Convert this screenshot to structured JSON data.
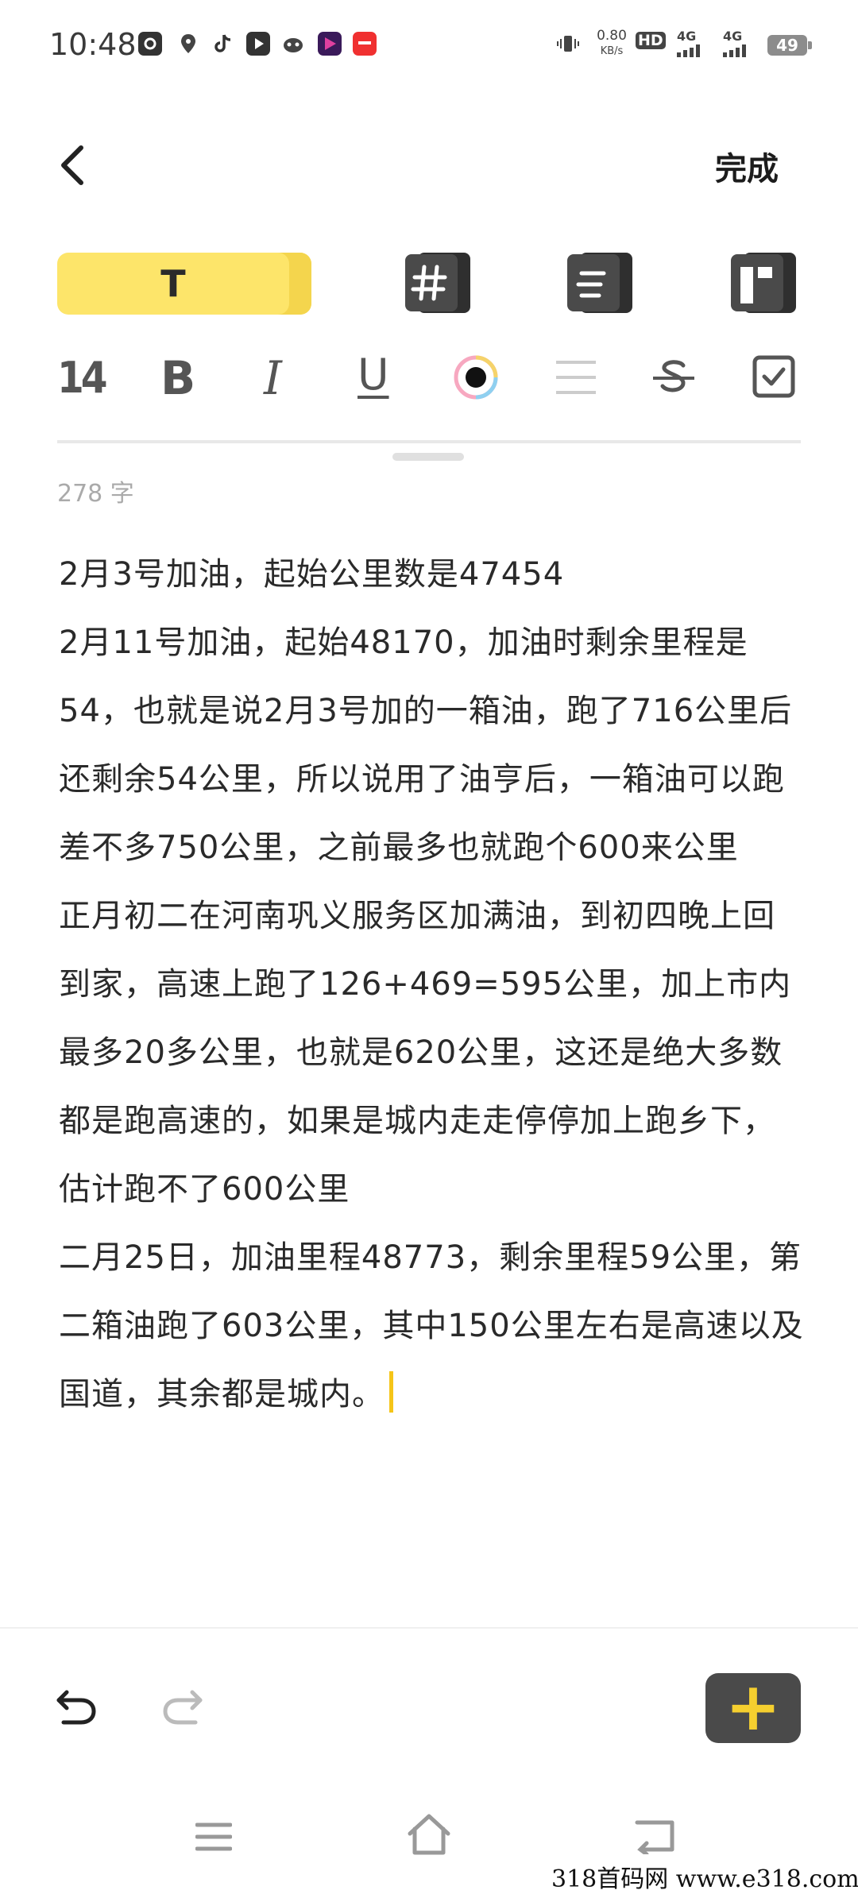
{
  "status_bar": {
    "time": "10:48",
    "net_speed_value": "0.80",
    "net_speed_unit": "KB/s",
    "hd_label": "HD",
    "sim1": "4G",
    "sim2": "4G",
    "battery": "49",
    "notification_icons": [
      "music-app-icon",
      "location-app-icon",
      "tiktok-icon",
      "video-app-icon",
      "cat-app-icon",
      "media-app-icon",
      "shop-app-icon"
    ]
  },
  "header": {
    "back_icon": "chevron-left-icon",
    "done_label": "完成"
  },
  "style_tabs": {
    "text_tab_label": "T",
    "icons": [
      "hashtag-tab-icon",
      "list-tab-icon",
      "layout-tab-icon"
    ]
  },
  "format_toolbar": {
    "font_size": "14",
    "bold": "B",
    "italic": "I",
    "underline": "U",
    "accent_color": "#fde56a"
  },
  "editor": {
    "word_count": "278 字",
    "paragraphs": [
      "2月3号加油，起始公里数是47454",
      "2月11号加油，起始48170，加油时剩余里程是54，也就是说2月3号加的一箱油，跑了716公里后还剩余54公里，所以说用了油亨后，一箱油可以跑差不多750公里，之前最多也就跑个600来公里",
      "正月初二在河南巩义服务区加满油，到初四晚上回到家，高速上跑了126+469=595公里，加上市内最多20多公里，也就是620公里，这还是绝大多数都是跑高速的，如果是城内走走停停加上跑乡下，估计跑不了600公里",
      "二月25日，加油里程48773，剩余里程59公里，第二箱油跑了603公里，其中150公里左右是高速以及国道，其余都是城内。"
    ]
  },
  "bottom_toolbar": {
    "add_label": "+"
  },
  "watermark": "318首码网  www.e318.com"
}
